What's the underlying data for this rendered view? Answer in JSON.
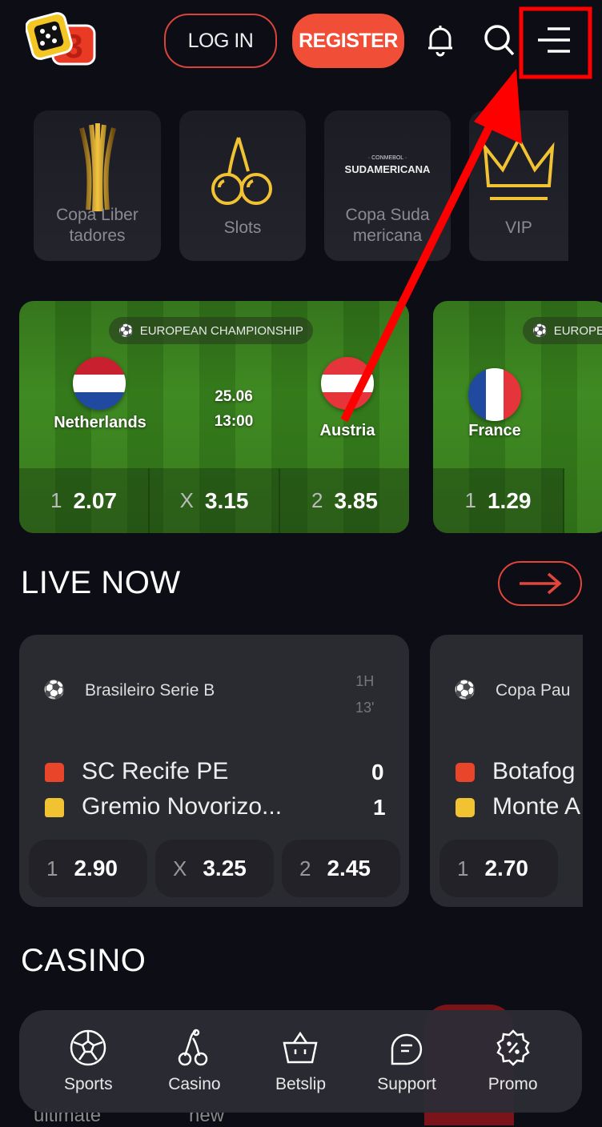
{
  "header": {
    "logo": "D3",
    "login_label": "LOG IN",
    "register_label": "REGISTER",
    "icons": [
      "bell-icon",
      "search-icon",
      "menu-icon"
    ]
  },
  "categories": [
    {
      "label": "Copa Liber tadores",
      "icon": "trophy-icon"
    },
    {
      "label": "Slots",
      "icon": "cherry-icon"
    },
    {
      "label": "Copa Suda mericana",
      "icon": "sudamericana-logo",
      "logo_text": "SUDAMERICANA",
      "logo_subtext": "· CONMEBOL ·"
    },
    {
      "label": "VIP",
      "icon": "crown-icon"
    }
  ],
  "featured": [
    {
      "league": "EUROPEAN CHAMPIONSHIP",
      "home": "Netherlands",
      "away": "Austria",
      "date": "25.06",
      "time": "13:00",
      "odds": [
        {
          "k": "1",
          "v": "2.07"
        },
        {
          "k": "X",
          "v": "3.15"
        },
        {
          "k": "2",
          "v": "3.85"
        }
      ]
    },
    {
      "league": "EUROPEAN CHAMPIONSHIP",
      "home": "France",
      "odds": [
        {
          "k": "1",
          "v": "1.29"
        }
      ]
    }
  ],
  "live": {
    "title": "LIVE NOW",
    "matches": [
      {
        "league": "Brasileiro Serie B",
        "period": "1H",
        "minute": "13'",
        "home": "SC Recife PE",
        "away": "Gremio Novorizo...",
        "home_score": "0",
        "away_score": "1",
        "odds": [
          {
            "k": "1",
            "v": "2.90"
          },
          {
            "k": "X",
            "v": "3.25"
          },
          {
            "k": "2",
            "v": "2.45"
          }
        ]
      },
      {
        "league": "Copa Pau",
        "home": "Botafog",
        "away": "Monte A",
        "odds": [
          {
            "k": "1",
            "v": "2.70"
          }
        ]
      }
    ]
  },
  "casino": {
    "title": "CASINO",
    "peek": [
      "ultimate",
      "new"
    ]
  },
  "bottom_nav": [
    {
      "label": "Sports",
      "icon": "soccer-ball-icon"
    },
    {
      "label": "Casino",
      "icon": "cherry-icon"
    },
    {
      "label": "Betslip",
      "icon": "basket-icon"
    },
    {
      "label": "Support",
      "icon": "chat-icon"
    },
    {
      "label": "Promo",
      "icon": "discount-badge-icon"
    }
  ],
  "colors": {
    "accent": "#f04e37",
    "background": "#0d0d16",
    "card": "#2a2a31",
    "gold": "#f1c232",
    "annotation": "#ff0000"
  }
}
